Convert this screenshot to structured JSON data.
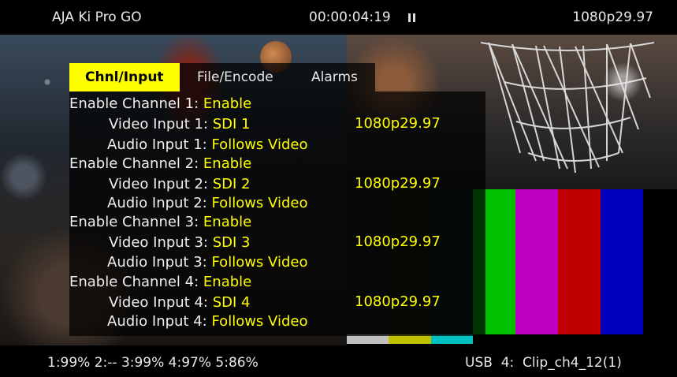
{
  "header": {
    "device_name": "AJA Ki Pro GO",
    "timecode": "00:00:04:19",
    "transport_state_icon": "pause-icon",
    "format": "1080p29.97"
  },
  "tabs": [
    {
      "label": "Chnl/Input",
      "active": true
    },
    {
      "label": "File/Encode",
      "active": false
    },
    {
      "label": "Alarms",
      "active": false
    }
  ],
  "channels": [
    {
      "enable_label": "Enable Channel 1:",
      "enable_value": "Enable",
      "video_label": "Video Input 1:",
      "video_value": "SDI 1",
      "audio_label": "Audio Input 1:",
      "audio_value": "Follows Video",
      "detected_format": "1080p29.97"
    },
    {
      "enable_label": "Enable Channel 2:",
      "enable_value": "Enable",
      "video_label": "Video Input 2:",
      "video_value": "SDI 2",
      "audio_label": "Audio Input 2:",
      "audio_value": "Follows Video",
      "detected_format": "1080p29.97"
    },
    {
      "enable_label": "Enable Channel 3:",
      "enable_value": "Enable",
      "video_label": "Video Input 3:",
      "video_value": "SDI 3",
      "audio_label": "Audio Input 3:",
      "audio_value": "Follows Video",
      "detected_format": "1080p29.97"
    },
    {
      "enable_label": "Enable Channel 4:",
      "enable_value": "Enable",
      "video_label": "Video Input 4:",
      "video_value": "SDI 4",
      "audio_label": "Audio Input 4:",
      "audio_value": "Follows Video",
      "detected_format": "1080p29.97"
    }
  ],
  "footer": {
    "media_status": "1:99% 2:-- 3:99% 4:97% 5:86%",
    "clip_status": "USB  4:  Clip_ch4_12(1)"
  },
  "colors": {
    "highlight": "#ffff00",
    "value_text": "#ffff00",
    "color_bars": [
      "#1a1a1a",
      "#1f1f10",
      "#0f2525",
      "#00c000",
      "#c000c0",
      "#c00000",
      "#0000c0",
      "#000000"
    ],
    "bottom_strip": [
      "#c0c0c0",
      "#c0c000",
      "#00c0c0",
      "#000000",
      "#000000",
      "#000000",
      "#000000",
      "#000000"
    ]
  }
}
